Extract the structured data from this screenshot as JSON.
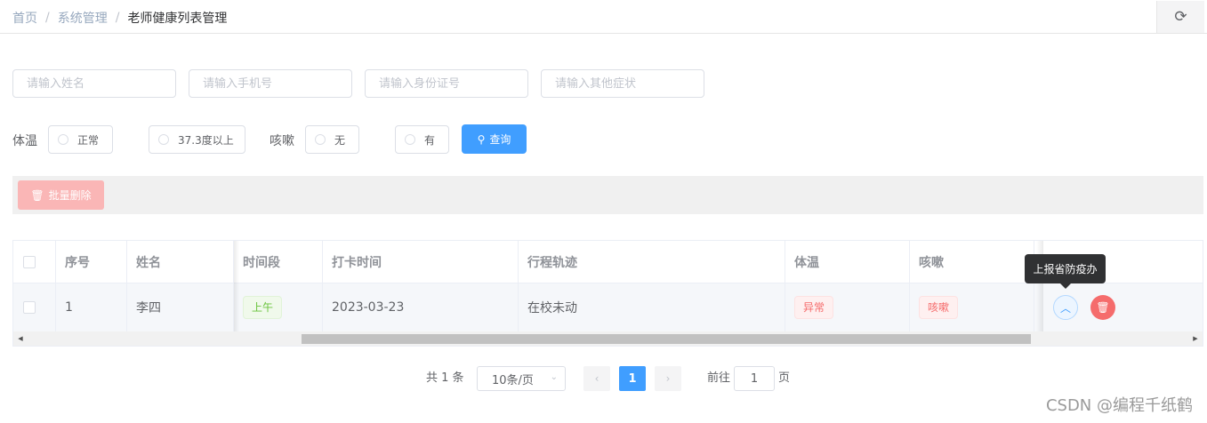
{
  "breadcrumb": [
    "首页",
    "系统管理",
    "老师健康列表管理"
  ],
  "breadcrumb_separator": "/",
  "refresh_icon": "refresh-icon",
  "search_inputs": {
    "name_placeholder": "请输入姓名",
    "phone_placeholder": "请输入手机号",
    "idcard_placeholder": "请输入身份证号",
    "symptom_placeholder": "请输入其他症状"
  },
  "filters": {
    "temp_label": "体温",
    "temp_options": [
      "正常",
      "37.3度以上"
    ],
    "cough_label": "咳嗽",
    "cough_options": [
      "无",
      "有"
    ],
    "search_label": "查询"
  },
  "toolbar": {
    "batch_delete_label": "批量删除"
  },
  "table": {
    "headers": [
      "序号",
      "姓名",
      "时间段",
      "打卡时间",
      "行程轨迹",
      "体温",
      "咳嗽"
    ],
    "rows": [
      {
        "index": "1",
        "name": "李四",
        "period": "上午",
        "checkin_time": "2023-03-23",
        "trajectory": "在校未动",
        "temperature": "异常",
        "cough": "咳嗽"
      }
    ],
    "tooltip": "上报省防疫办"
  },
  "pagination": {
    "total": "共 1 条",
    "page_size": "10条/页",
    "current_page": "1",
    "goto_prefix": "前往",
    "goto_value": "1",
    "goto_suffix": "页"
  },
  "watermark": "CSDN @编程千纸鹤",
  "colors": {
    "primary": "#409eff",
    "danger": "#f56c6c",
    "success": "#67c23a"
  }
}
